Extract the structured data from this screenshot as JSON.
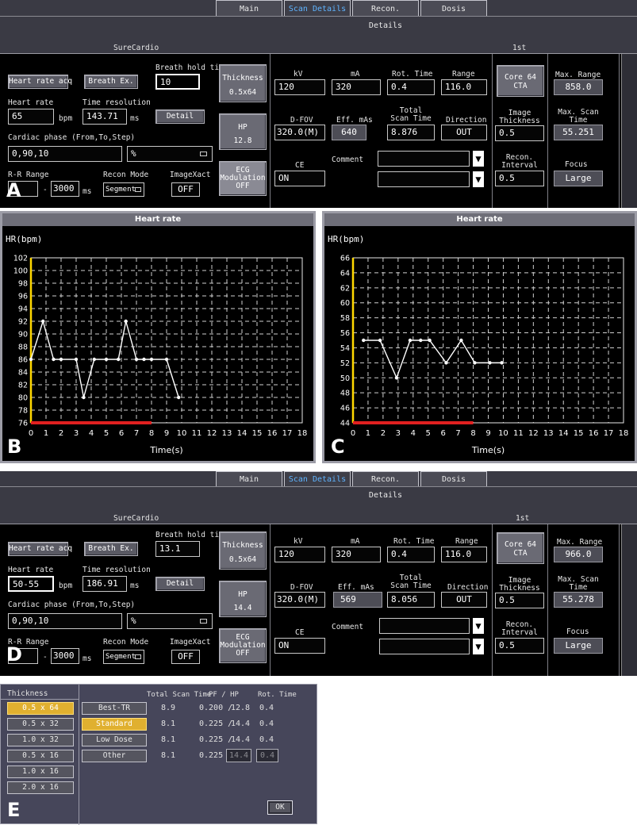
{
  "tabs": [
    "Main",
    "Scan Details",
    "Recon. Details",
    "Dosis"
  ],
  "panel_a": {
    "letter": "A",
    "section_title": "SureCardio",
    "series_label": "1st",
    "heart_rate_acq": "Heart rate acq",
    "breath_ex": "Breath Ex.",
    "breath_hold_label": "Breath hold time",
    "breath_hold_value": "10",
    "heart_rate_label": "Heart rate",
    "heart_rate_value": "65",
    "bpm": "bpm",
    "time_res_label": "Time resolution",
    "time_res_value": "143.71",
    "ms": "ms",
    "detail": "Detail",
    "cardiac_phase_label": "Cardiac phase (From,To,Step)",
    "cardiac_phase_value": "0,90,10",
    "percent": "%",
    "rr_label": "R-R Range",
    "rr_value": "3000",
    "dash": "-",
    "recon_mode_label": "Recon Mode",
    "recon_mode_value": "Segment",
    "imagexact_label": "ImageXact",
    "imagexact_value": "OFF",
    "thickness_btn": [
      "Thickness",
      "0.5x64"
    ],
    "hp_btn": [
      "HP",
      "12.8"
    ],
    "ecg_btn": [
      "ECG",
      "Modulation",
      "OFF"
    ],
    "kv_label": "kV",
    "kv_value": "120",
    "ma_label": "mA",
    "ma_value": "320",
    "rot_label": "Rot. Time",
    "rot_value": "0.4",
    "range_label": "Range",
    "range_value": "116.0",
    "dfov_label": "D-FOV",
    "dfov_value": "320.0(M)",
    "effmas_label": "Eff. mAs",
    "effmas_value": "640",
    "tst_label": [
      "Total",
      "Scan Time"
    ],
    "tst_value": "8.876",
    "dir_label": "Direction",
    "dir_value": "OUT",
    "ce_label": "CE",
    "ce_value": "ON",
    "comment_label": "Comment",
    "core_btn": [
      "Core 64",
      "CTA"
    ],
    "img_thick_label": [
      "Image",
      "Thickness"
    ],
    "img_thick_value": "0.5",
    "recon_int_label": [
      "Recon.",
      "Interval"
    ],
    "recon_int_value": "0.5",
    "max_range_label": "Max. Range",
    "max_range_value": "858.0",
    "max_scan_label": [
      "Max. Scan",
      "Time"
    ],
    "max_scan_value": "55.251",
    "focus_label": "Focus",
    "focus_value": "Large"
  },
  "panel_d": {
    "letter": "D",
    "section_title": "SureCardio",
    "series_label": "1st",
    "heart_rate_acq": "Heart rate acq",
    "breath_ex": "Breath Ex.",
    "breath_hold_label": "Breath hold time",
    "breath_hold_value": "13.1",
    "heart_rate_label": "Heart rate",
    "heart_rate_value": "50-55",
    "bpm": "bpm",
    "time_res_label": "Time resolution",
    "time_res_value": "186.91",
    "ms": "ms",
    "detail": "Detail",
    "cardiac_phase_label": "Cardiac phase (From,To,Step)",
    "cardiac_phase_value": "0,90,10",
    "percent": "%",
    "rr_label": "R-R Range",
    "rr_value": "3000",
    "dash": "-",
    "recon_mode_label": "Recon Mode",
    "recon_mode_value": "Segment",
    "imagexact_label": "ImageXact",
    "imagexact_value": "OFF",
    "thickness_btn": [
      "Thickness",
      "0.5x64"
    ],
    "hp_btn": [
      "HP",
      "14.4"
    ],
    "ecg_btn": [
      "ECG",
      "Modulation",
      "OFF"
    ],
    "kv_label": "kV",
    "kv_value": "120",
    "ma_label": "mA",
    "ma_value": "320",
    "rot_label": "Rot. Time",
    "rot_value": "0.4",
    "range_label": "Range",
    "range_value": "116.0",
    "dfov_label": "D-FOV",
    "dfov_value": "320.0(M)",
    "effmas_label": "Eff. mAs",
    "effmas_value": "569",
    "tst_label": [
      "Total",
      "Scan Time"
    ],
    "tst_value": "8.056",
    "dir_label": "Direction",
    "dir_value": "OUT",
    "ce_label": "CE",
    "ce_value": "ON",
    "comment_label": "Comment",
    "core_btn": [
      "Core 64",
      "CTA"
    ],
    "img_thick_label": [
      "Image",
      "Thickness"
    ],
    "img_thick_value": "0.5",
    "recon_int_label": [
      "Recon.",
      "Interval"
    ],
    "recon_int_value": "0.5",
    "max_range_label": "Max. Range",
    "max_range_value": "966.0",
    "max_scan_label": [
      "Max. Scan",
      "Time"
    ],
    "max_scan_value": "55.278",
    "focus_label": "Focus",
    "focus_value": "Large"
  },
  "chart_data": [
    {
      "type": "line",
      "panel": "B",
      "title": "Heart rate",
      "ylabel": "HR(bpm)",
      "xlabel": "Time(s)",
      "xlim": [
        0,
        18
      ],
      "ylim": [
        76,
        102
      ],
      "x_ticks": [
        0,
        1,
        2,
        3,
        4,
        5,
        6,
        7,
        8,
        9,
        10,
        11,
        12,
        13,
        14,
        15,
        16,
        17,
        18
      ],
      "y_ticks": [
        76,
        78,
        80,
        82,
        84,
        86,
        88,
        90,
        92,
        94,
        96,
        98,
        100,
        102
      ],
      "grid": true,
      "x": [
        0,
        0.8,
        1.5,
        2,
        3,
        3.5,
        4.2,
        5,
        5.8,
        6.3,
        7,
        7.5,
        8,
        9,
        9.8
      ],
      "values": [
        86,
        92,
        86,
        86,
        86,
        80,
        86,
        86,
        86,
        92,
        86,
        86,
        86,
        86,
        80
      ],
      "scan_interval": [
        0,
        8
      ]
    },
    {
      "type": "line",
      "panel": "C",
      "title": "Heart rate",
      "ylabel": "HR(bpm)",
      "xlabel": "Time(s)",
      "xlim": [
        0,
        18
      ],
      "ylim": [
        44,
        66
      ],
      "x_ticks": [
        0,
        1,
        2,
        3,
        4,
        5,
        6,
        7,
        8,
        9,
        10,
        11,
        12,
        13,
        14,
        15,
        16,
        17,
        18
      ],
      "y_ticks": [
        44,
        46,
        48,
        50,
        52,
        54,
        56,
        58,
        60,
        62,
        64,
        66
      ],
      "grid": true,
      "x": [
        0.7,
        1.8,
        2.9,
        3.8,
        4.5,
        5.1,
        6.2,
        7.2,
        8.1,
        9.1,
        9.9
      ],
      "values": [
        55,
        55,
        50,
        55,
        55,
        55,
        52,
        55,
        52,
        52,
        52
      ],
      "scan_interval": [
        0,
        8
      ]
    }
  ],
  "panel_e": {
    "letter": "E",
    "thickness_label": "Thickness",
    "thickness_options": [
      "0.5 x 64",
      "0.5 x 32",
      "1.0 x 32",
      "0.5 x 16",
      "1.0 x 16",
      "2.0 x 16"
    ],
    "col_total_scan": "Total Scan Time",
    "col_pf_hp": "PF / HP",
    "col_rot": "Rot. Time",
    "rows": [
      {
        "name": "Best-TR",
        "scan": "8.9",
        "pf": "0.200 /",
        "hp": "12.8",
        "rot": "0.4"
      },
      {
        "name": "Standard",
        "scan": "8.1",
        "pf": "0.225 /",
        "hp": "14.4",
        "rot": "0.4"
      },
      {
        "name": "Low Dose",
        "scan": "8.1",
        "pf": "0.225 /",
        "hp": "14.4",
        "rot": "0.4"
      },
      {
        "name": "Other",
        "scan": "8.1",
        "pf": "0.225 /",
        "hp": "14.4",
        "rot": "0.4"
      }
    ],
    "ok": "OK"
  },
  "colors": {
    "panel_bg": "#000000",
    "frame": "#3a3a44",
    "tab_active_text": "#5fb4ff",
    "selected": "#e0b030",
    "hr_line": "#ffffff",
    "scan_bar": "#e02020",
    "y_axis_bar": "#ffd800"
  }
}
